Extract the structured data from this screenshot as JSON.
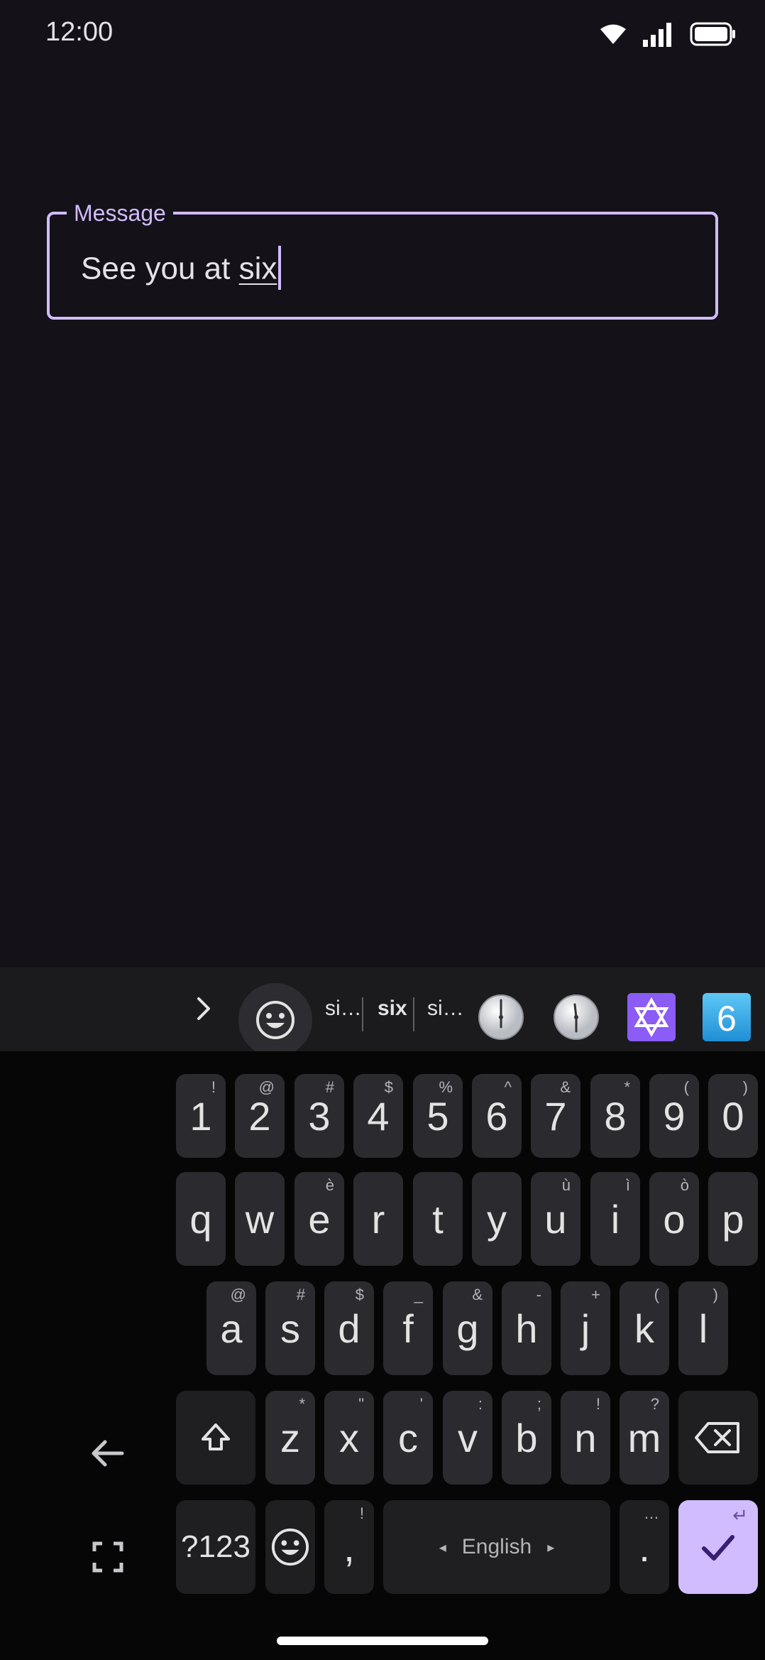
{
  "status_bar": {
    "time": "12:00"
  },
  "text_field": {
    "label": "Message",
    "value_prefix": "See you at ",
    "composing_word": "six"
  },
  "keyboard": {
    "suggestions": [
      "si…",
      "six",
      "si…"
    ],
    "emoji_suggestions": [
      "clock-icon",
      "clock-icon",
      "star-of-david-icon",
      "keycap-six-icon"
    ],
    "emoji_keycap_text": "6",
    "row_numbers": [
      {
        "key": "1",
        "hint": "!"
      },
      {
        "key": "2",
        "hint": "@"
      },
      {
        "key": "3",
        "hint": "#"
      },
      {
        "key": "4",
        "hint": "$"
      },
      {
        "key": "5",
        "hint": "%"
      },
      {
        "key": "6",
        "hint": "^"
      },
      {
        "key": "7",
        "hint": "&"
      },
      {
        "key": "8",
        "hint": "*"
      },
      {
        "key": "9",
        "hint": "("
      },
      {
        "key": "0",
        "hint": ")"
      }
    ],
    "row_top": [
      {
        "key": "q",
        "hint": ""
      },
      {
        "key": "w",
        "hint": ""
      },
      {
        "key": "e",
        "hint": "è"
      },
      {
        "key": "r",
        "hint": ""
      },
      {
        "key": "t",
        "hint": ""
      },
      {
        "key": "y",
        "hint": ""
      },
      {
        "key": "u",
        "hint": "ù"
      },
      {
        "key": "i",
        "hint": "ì"
      },
      {
        "key": "o",
        "hint": "ò"
      },
      {
        "key": "p",
        "hint": ""
      }
    ],
    "row_home": [
      {
        "key": "a",
        "hint": "@"
      },
      {
        "key": "s",
        "hint": "#"
      },
      {
        "key": "d",
        "hint": "$"
      },
      {
        "key": "f",
        "hint": "_"
      },
      {
        "key": "g",
        "hint": "&"
      },
      {
        "key": "h",
        "hint": "-"
      },
      {
        "key": "j",
        "hint": "+"
      },
      {
        "key": "k",
        "hint": "("
      },
      {
        "key": "l",
        "hint": ")"
      }
    ],
    "row_bottom": [
      {
        "key": "z",
        "hint": "*"
      },
      {
        "key": "x",
        "hint": "\""
      },
      {
        "key": "c",
        "hint": "'"
      },
      {
        "key": "v",
        "hint": ":"
      },
      {
        "key": "b",
        "hint": ";"
      },
      {
        "key": "n",
        "hint": "!"
      },
      {
        "key": "m",
        "hint": "?"
      }
    ],
    "symbols_label": "?123",
    "comma": {
      "key": ",",
      "hint": "!"
    },
    "space_label": "English",
    "space_left_arrow": "◂",
    "space_right_arrow": "▸",
    "period": {
      "key": ".",
      "hint": "…"
    },
    "enter_hint": "↵"
  },
  "colors": {
    "background": "#141218",
    "accent": "#d0bcff",
    "key": "#2b2b2f",
    "keyboard": "#060606"
  }
}
